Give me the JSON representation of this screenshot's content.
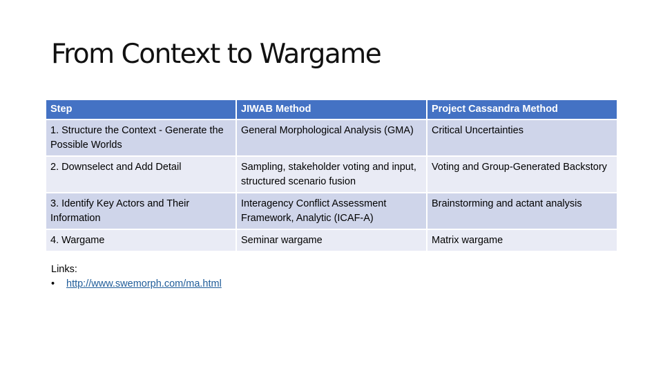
{
  "slide": {
    "title": "From Context to Wargame"
  },
  "table": {
    "headers": [
      "Step",
      "JIWAB Method",
      "Project Cassandra Method"
    ],
    "rows": [
      [
        "1. Structure the Context - Generate the Possible Worlds",
        "General Morphological Analysis (GMA)",
        "Critical Uncertainties"
      ],
      [
        "2. Downselect and Add Detail",
        "Sampling, stakeholder voting and input, structured scenario fusion",
        "Voting and Group-Generated Backstory"
      ],
      [
        "3. Identify Key Actors and Their Information",
        "Interagency Conflict Assessment Framework, Analytic (ICAF-A)",
        "Brainstorming and actant analysis"
      ],
      [
        "4. Wargame",
        "Seminar wargame",
        "Matrix wargame"
      ]
    ],
    "colors": {
      "header_bg": "#4472c4",
      "row_odd_bg": "#cfd5ea",
      "row_even_bg": "#e9ebf5"
    }
  },
  "links": {
    "label": "Links:",
    "bullet": "•",
    "items": [
      {
        "text": "http://www.swemorph.com/ma.html"
      }
    ],
    "link_color": "#1f5c99"
  }
}
